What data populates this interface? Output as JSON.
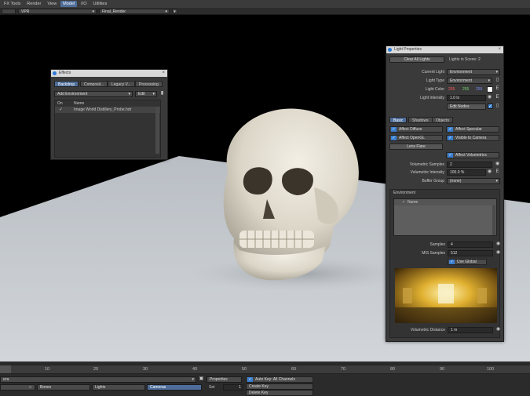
{
  "menubar": {
    "items": [
      "FX Tools",
      "Render",
      "View",
      "Model",
      "I/O",
      "Utilities"
    ],
    "active_index": 3
  },
  "toolbar": {
    "viewport_mode": "VPR",
    "render_mode": "Final_Render"
  },
  "effects_panel": {
    "title": "Effects",
    "tabs": [
      "Backdrop",
      "Composit...",
      "Legacy V...",
      "Processing"
    ],
    "active_tab": 0,
    "add_env_label": "Add Environment",
    "edit_label": "Edit",
    "col_on": "On",
    "col_name": "Name",
    "row_name": "Image World Distillery_Probe.hdr",
    "row_on": "✓"
  },
  "light_panel": {
    "title": "Light Properties",
    "clear_all": "Clear All Lights",
    "lights_in_scene": "Lights in Scene: 2",
    "current_light_label": "Current Light",
    "current_light": "Environment",
    "light_type_label": "Light Type",
    "light_type": "Environment",
    "light_color_label": "Light Color",
    "color_r": "255",
    "color_g": "255",
    "color_b": "255",
    "e_label": "E",
    "intensity_label": "Light Intensity",
    "intensity": "1.0 lx",
    "edit_nodes": "Edit Nodes",
    "tabs": [
      "Basic",
      "Shadows",
      "Objects"
    ],
    "active_tab": 0,
    "affect_diffuse": "Affect Diffuse",
    "affect_specular": "Affect Specular",
    "affect_opengl": "Affect OpenGL",
    "visible_to_camera": "Visible to Camera",
    "lens_flare": "Lens Flare",
    "affect_volumetrics": "Affect Volumetrics",
    "vol_samples_label": "Volumetric Samples",
    "vol_samples": "2",
    "vol_intensity_label": "Volumetric Intensity",
    "vol_intensity": "100.0 %",
    "buffer_group_label": "Buffer Group",
    "buffer_group": "(none)",
    "env_section": "Environment",
    "env_col_name": "Name",
    "env_col_check": "✓",
    "samples_label": "Samples",
    "samples": "4",
    "mis_label": "MIS Samples",
    "mis": "512",
    "use_global": "Use Global",
    "vol_distance_label": "Volumetric Distance",
    "vol_distance": "1 m"
  },
  "timeline": {
    "ticks": [
      "10",
      "20",
      "30",
      "40",
      "50",
      "60",
      "70",
      "80",
      "90",
      "100"
    ]
  },
  "bottom": {
    "item_left": "era",
    "bones": "Bones",
    "lights": "Lights",
    "cameras": "Cameras",
    "properties": "Properties",
    "set": "Set",
    "set_value": "1",
    "auto_key": "Auto Key: All Channels",
    "create_key": "Create Key",
    "delete_key": "Delete Key"
  }
}
